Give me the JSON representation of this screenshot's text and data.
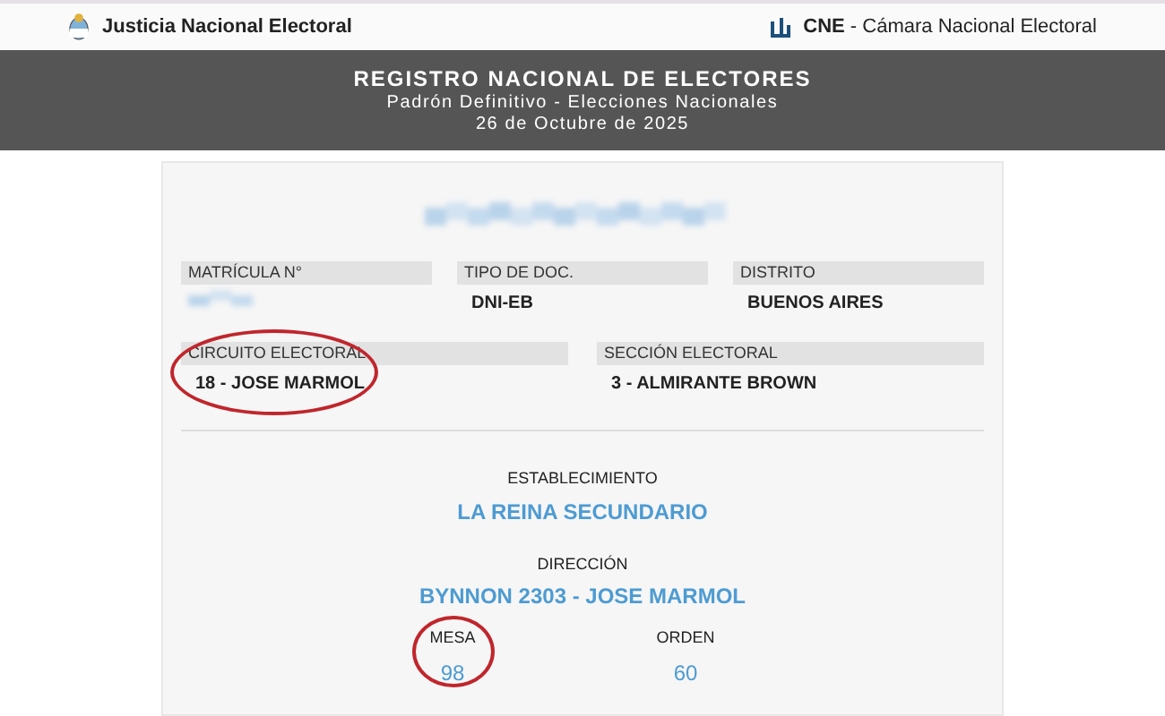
{
  "top_bar": {
    "left_title": "Justicia Nacional Electoral",
    "right_brand": "CNE",
    "right_title": " - Cámara Nacional Electoral"
  },
  "header": {
    "title": "REGISTRO NACIONAL DE ELECTORES",
    "subtitle": "Padrón Definitivo - Elecciones Nacionales",
    "date": "26 de Octubre de 2025"
  },
  "voter_name": {
    "redacted": true
  },
  "fields_row_1": [
    {
      "label": "MATRÍCULA N°",
      "value_redacted": true,
      "circled": false
    },
    {
      "label": "TIPO DE DOC.",
      "value": "DNI-EB",
      "circled": false
    },
    {
      "label": "DISTRITO",
      "value": "BUENOS AIRES",
      "circled": false
    }
  ],
  "fields_row_2": [
    {
      "label": "CIRCUITO ELECTORAL",
      "value": "18 - JOSE MARMOL",
      "circled": true
    },
    {
      "label": "SECCIÓN ELECTORAL",
      "value": "3 - ALMIRANTE BROWN",
      "circled": false
    }
  ],
  "establecimiento": {
    "label": "ESTABLECIMIENTO",
    "value": "LA REINA SECUNDARIO"
  },
  "direccion": {
    "label": "DIRECCIÓN",
    "value": "BYNNON 2303 - JOSE MARMOL"
  },
  "bottom_fields": [
    {
      "label": "MESA",
      "value": "98",
      "circled": true
    },
    {
      "label": "ORDEN",
      "value": "60",
      "circled": false
    }
  ]
}
